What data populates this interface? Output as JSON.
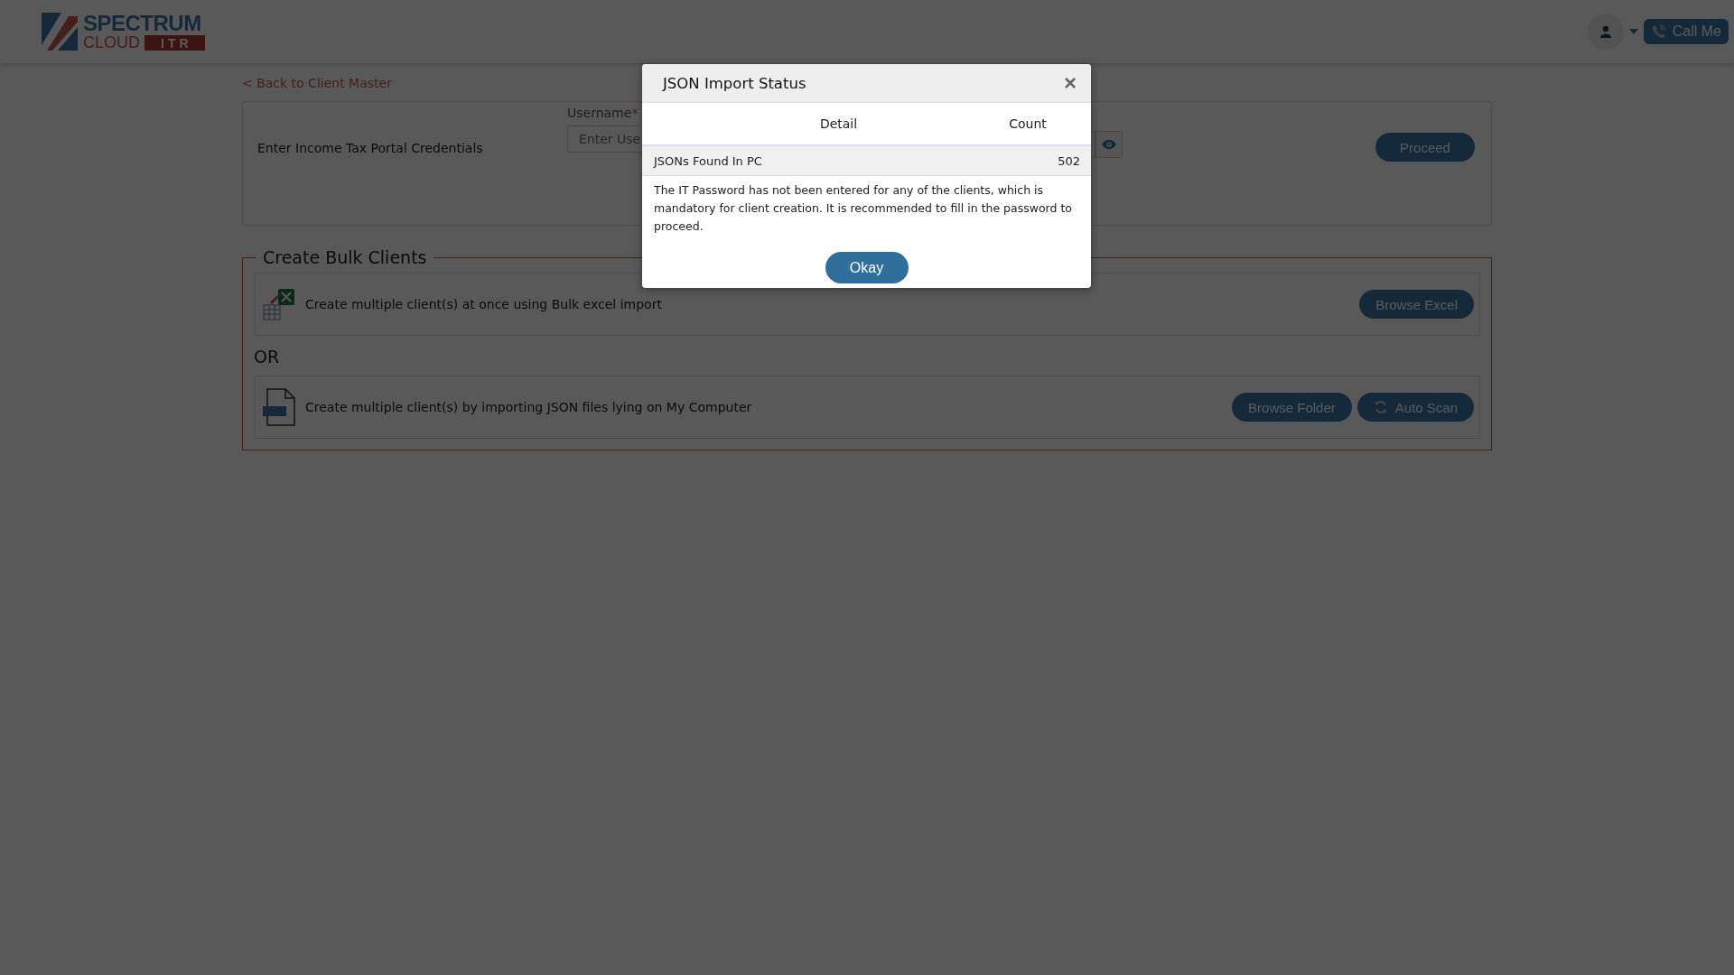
{
  "header": {
    "logo": {
      "line1": "SPECTRUM",
      "line2": "CLOUD",
      "badge": "ITR"
    },
    "call_button": "Call Me"
  },
  "back_link": "< Back to Client Master",
  "credentials": {
    "label": "Enter Income Tax Portal Credentials",
    "username_label": "Username",
    "required_mark": "*",
    "username_placeholder": "Enter Use",
    "proceed_button": "Proceed"
  },
  "bulk": {
    "title": "Create Bulk Clients",
    "separator": "OR",
    "options": [
      {
        "kind": "excel",
        "text": "Create multiple client(s) at once using Bulk excel import",
        "buttons": [
          {
            "label": "Browse Excel",
            "kind": "plain"
          }
        ]
      },
      {
        "kind": "json",
        "text": "Create multiple client(s) by importing JSON files lying on My Computer",
        "buttons": [
          {
            "label": "Browse Folder",
            "kind": "plain"
          },
          {
            "label": "Auto Scan",
            "kind": "refresh"
          }
        ]
      }
    ]
  },
  "modal": {
    "title": "JSON Import Status",
    "close": "×",
    "columns": [
      "Detail",
      "Count"
    ],
    "rows": [
      {
        "detail": "JSONs Found In PC",
        "count": "502"
      }
    ],
    "message": "The IT Password has not been entered for any of the clients, which is mandatory for client creation. It is recommended to fill in the password to proceed.",
    "ok_button": "Okay"
  }
}
